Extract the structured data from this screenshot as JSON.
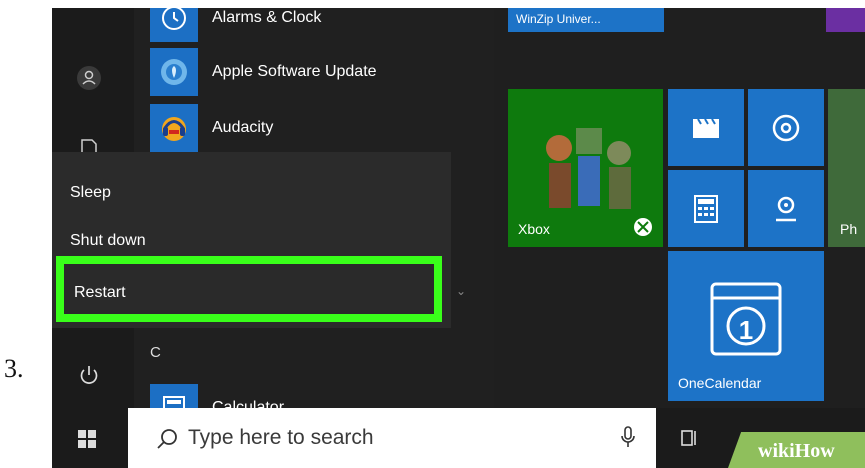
{
  "step_number": "3.",
  "apps": [
    {
      "label": "Alarms & Clock",
      "icon": "clock-icon"
    },
    {
      "label": "Apple Software Update",
      "icon": "apple-update-icon"
    },
    {
      "label": "Audacity",
      "icon": "audacity-icon"
    },
    {
      "label": "Calculator",
      "icon": "calculator-icon"
    }
  ],
  "section_letter": "C",
  "power_menu": {
    "sleep": "Sleep",
    "shutdown": "Shut down",
    "restart": "Restart"
  },
  "tiles": {
    "winzip": "WinZip Univer...",
    "xbox": "Xbox",
    "onecalendar": "OneCalendar",
    "onecalendar_date": "1",
    "photos": "Ph"
  },
  "taskbar": {
    "search_placeholder": "Type here to search",
    "watermark": "wikiHow"
  },
  "colors": {
    "highlight": "#39ff1a",
    "tile_blue": "#1d73c7",
    "xbox_green": "#0e7a0d"
  }
}
